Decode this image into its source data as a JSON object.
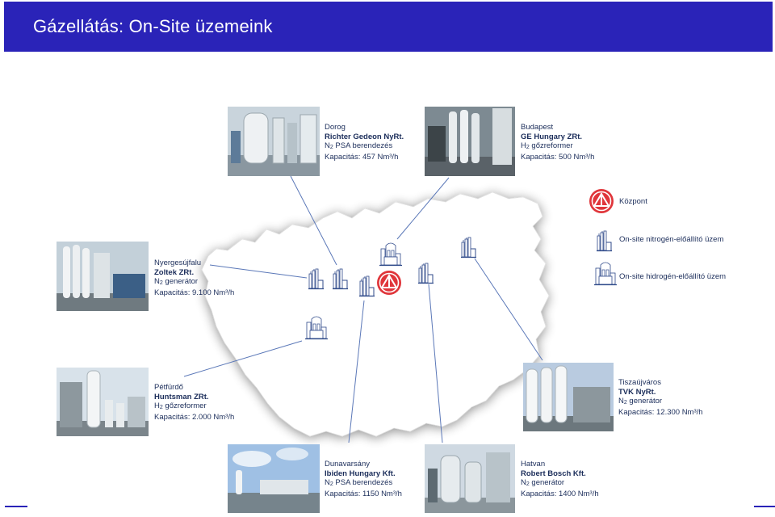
{
  "header": {
    "title": "Gázellátás: On-Site üzemeink"
  },
  "colors": {
    "header_bg": "#2a23b8",
    "text": "#1b2d5a",
    "logo_red": "#e0363b",
    "line": "#5b78b8"
  },
  "legend": [
    {
      "icon": "kozpont-logo-icon",
      "label": "Központ"
    },
    {
      "icon": "nitrogen-plant-icon",
      "label": "On-site nitrogén-előállító üzem"
    },
    {
      "icon": "hydrogen-plant-icon",
      "label": "On-site hidrogén-előállító üzem"
    }
  ],
  "sites": [
    {
      "city": "Dorog",
      "company": "Richter Gedeon NyRt.",
      "equip_pre": "N",
      "equip_sub": "2",
      "equip_post": " PSA berendezés",
      "capacity": "Kapacitás: 457 Nm³/h"
    },
    {
      "city": "Budapest",
      "company": "GE Hungary ZRt.",
      "equip_pre": "H",
      "equip_sub": "2",
      "equip_post": " gőzreformer",
      "capacity": "Kapacitás: 500 Nm³/h"
    },
    {
      "city": "Nyergesújfalu",
      "company": "Zoltek ZRt.",
      "equip_pre": "N",
      "equip_sub": "2",
      "equip_post": " generátor",
      "capacity": "Kapacitás: 9.100 Nm³/h"
    },
    {
      "city": "Pétfürdő",
      "company": "Huntsman ZRt.",
      "equip_pre": "H",
      "equip_sub": "2",
      "equip_post": " gőzreformer",
      "capacity": "Kapacitás: 2.000 Nm³/h"
    },
    {
      "city": "Tiszaújváros",
      "company": "TVK NyRt.",
      "equip_pre": "N",
      "equip_sub": "2",
      "equip_post": " generátor",
      "capacity": "Kapacitás: 12.300 Nm³/h"
    },
    {
      "city": "Dunavarsány",
      "company": "Ibiden Hungary Kft.",
      "equip_pre": "N",
      "equip_sub": "2",
      "equip_post": " PSA berendezés",
      "capacity": "Kapacitás: 1150 Nm³/h"
    },
    {
      "city": "Hatvan",
      "company": "Robert Bosch Kft.",
      "equip_pre": "N",
      "equip_sub": "2",
      "equip_post": " generátor",
      "capacity": "Kapacitás: 1400 Nm³/h"
    }
  ]
}
